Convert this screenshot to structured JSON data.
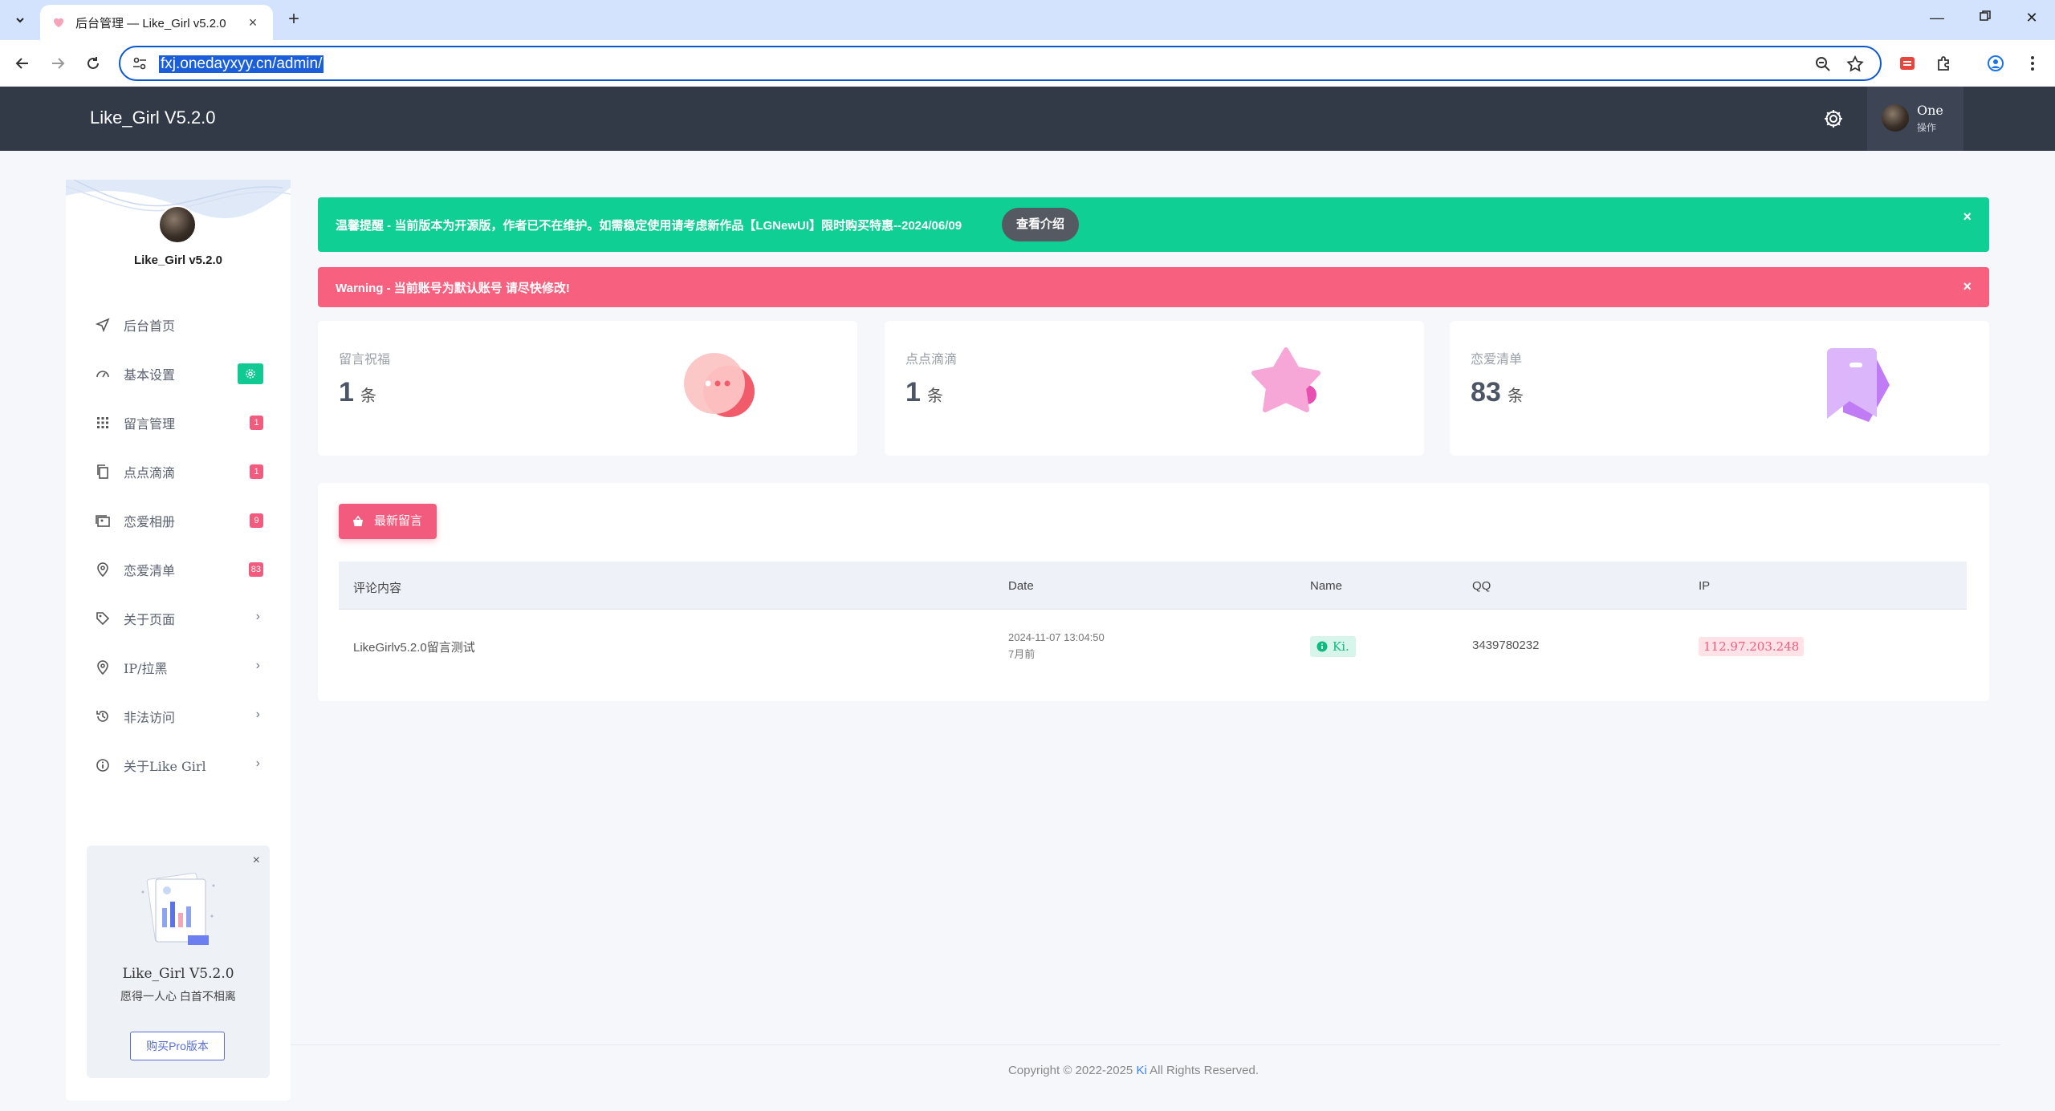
{
  "browser": {
    "tab_title": "后台管理 — Like_Girl v5.2.0",
    "url": "fxj.onedayxyy.cn/admin/"
  },
  "header": {
    "app_title": "Like_Girl V5.2.0",
    "user_name": "One",
    "user_role": "操作"
  },
  "sidebar": {
    "brand": "Like_Girl v5.2.0",
    "items": [
      {
        "label": "后台首页",
        "icon": "send-icon"
      },
      {
        "label": "基本设置",
        "icon": "gauge-icon",
        "badge_icon": "settings-icon"
      },
      {
        "label": "留言管理",
        "icon": "grid-icon",
        "badge": "1"
      },
      {
        "label": "点点滴滴",
        "icon": "copy-icon",
        "badge": "1"
      },
      {
        "label": "恋爱相册",
        "icon": "images-icon",
        "badge": "9"
      },
      {
        "label": "恋爱清单",
        "icon": "map-pin-icon",
        "badge": "83"
      },
      {
        "label": "关于页面",
        "icon": "tag-icon"
      },
      {
        "label": "IP/拉黑",
        "icon": "map-pin-icon"
      },
      {
        "label": "非法访问",
        "icon": "history-icon"
      },
      {
        "label": "关于Like Girl",
        "icon": "info-icon"
      }
    ],
    "promo": {
      "title": "Like_Girl V5.2.0",
      "subtitle": "愿得一人心 白首不相离",
      "button": "购买Pro版本"
    }
  },
  "alerts": {
    "info_text": "温馨提醒 - 当前版本为开源版，作者已不在维护。如需稳定使用请考虑新作品【LGNewUI】限时购买特惠--2024/06/09",
    "info_button": "查看介绍",
    "warning_text": "Warning - 当前账号为默认账号 请尽快修改!",
    "close_glyph": "×"
  },
  "stats": [
    {
      "label": "留言祝福",
      "value": "1",
      "unit": "条"
    },
    {
      "label": "点点滴滴",
      "value": "1",
      "unit": "条"
    },
    {
      "label": "恋爱清单",
      "value": "83",
      "unit": "条"
    }
  ],
  "panel": {
    "button": "最新留言",
    "columns": [
      "评论内容",
      "Date",
      "Name",
      "QQ",
      "IP"
    ],
    "rows": [
      {
        "content": "LikeGirlv5.2.0留言测试",
        "date": "2024-11-07 13:04:50",
        "relative": "7月前",
        "name": "Ki.",
        "qq": "3439780232",
        "ip": "112.97.203.248"
      }
    ]
  },
  "footer": {
    "prefix": "Copyright © 2022-2025 ",
    "link": "Ki",
    "suffix": " All Rights Reserved."
  },
  "colors": {
    "header_bg": "#323a48",
    "info_alert": "#0fcf94",
    "warn_alert": "#f8607f",
    "accent_pink": "#f25b7d",
    "accent_green": "#10c993"
  }
}
